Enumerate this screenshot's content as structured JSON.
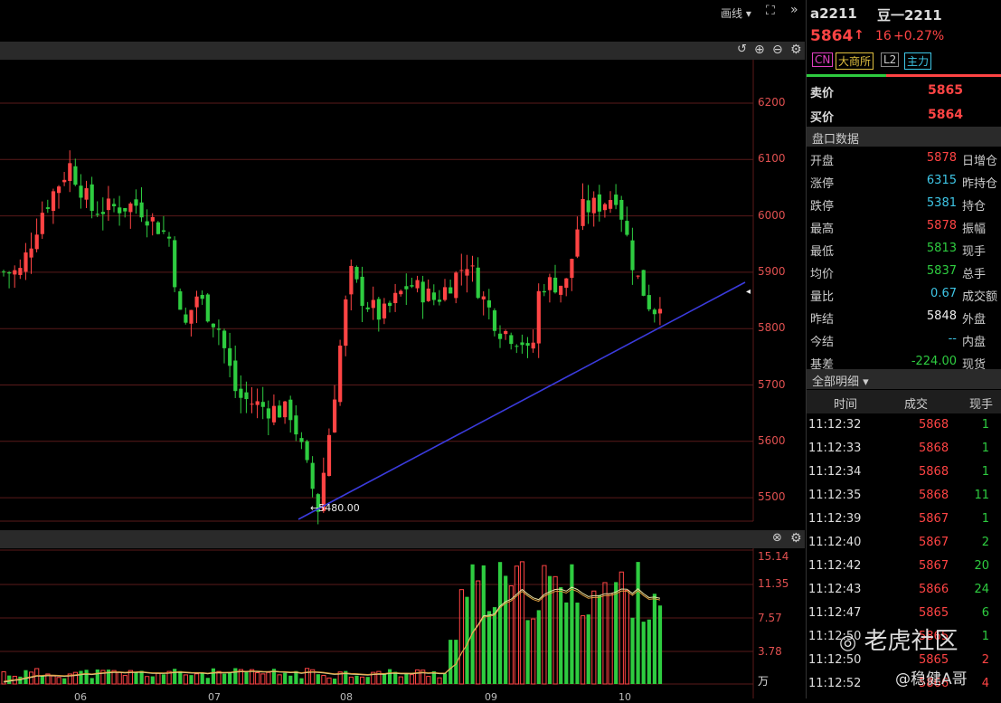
{
  "toolbar": {
    "draw_label": "画线 ▾",
    "fullscreen_icon": "expand-icon",
    "collapse_icon": "double-chevron-right-icon"
  },
  "chart_toolbar": {
    "icons": [
      "undo-icon",
      "zoom-in-icon",
      "zoom-out-icon",
      "gear-icon"
    ]
  },
  "vol_toolbar": {
    "icons": [
      "close-icon",
      "gear-icon"
    ]
  },
  "price_axis": [
    "6200",
    "6100",
    "6000",
    "5900",
    "5800",
    "5700",
    "5600",
    "5500"
  ],
  "vol_axis": [
    "15.14",
    "11.35",
    "7.57",
    "3.78",
    "万"
  ],
  "date_axis": [
    "06",
    "07",
    "08",
    "09",
    "10"
  ],
  "annotation": "←5480.00",
  "colors": {
    "up": "#ff4444",
    "down": "#2ecc40",
    "trendline": "#3b3bdd",
    "grid": "#5a1a1a"
  },
  "header": {
    "code": "a2211",
    "name": "豆一2211",
    "price": "5864",
    "arrow": "↑",
    "change": "16",
    "pct": "+0.27%"
  },
  "tags": [
    "CN",
    "大商所",
    "L2",
    "主力"
  ],
  "quote": {
    "sell_label": "卖价",
    "sell": "5865",
    "buy_label": "买价",
    "buy": "5864"
  },
  "panel_title": "盘口数据",
  "stats": [
    {
      "label": "开盘",
      "value": "5878",
      "color": "red",
      "label2": "日增仓"
    },
    {
      "label": "涨停",
      "value": "6315",
      "color": "cyan",
      "label2": "昨持仓"
    },
    {
      "label": "跌停",
      "value": "5381",
      "color": "cyan",
      "label2": "持仓"
    },
    {
      "label": "最高",
      "value": "5878",
      "color": "red",
      "label2": "振幅"
    },
    {
      "label": "最低",
      "value": "5813",
      "color": "green",
      "label2": "现手"
    },
    {
      "label": "均价",
      "value": "5837",
      "color": "green",
      "label2": "总手"
    },
    {
      "label": "量比",
      "value": "0.67",
      "color": "cyan",
      "label2": "成交额"
    },
    {
      "label": "昨结",
      "value": "5848",
      "color": "white",
      "label2": "外盘"
    },
    {
      "label": "今结",
      "value": "--",
      "color": "cyan",
      "label2": "内盘"
    },
    {
      "label": "基差",
      "value": "-224.00",
      "color": "green",
      "label2": "现货"
    }
  ],
  "trades_title": "全部明细 ▾",
  "trades_headers": [
    "时间",
    "成交",
    "现手"
  ],
  "trades": [
    {
      "time": "11:12:32",
      "price": "5868",
      "qty": "1",
      "color": "green"
    },
    {
      "time": "11:12:33",
      "price": "5868",
      "qty": "1",
      "color": "green"
    },
    {
      "time": "11:12:34",
      "price": "5868",
      "qty": "1",
      "color": "green"
    },
    {
      "time": "11:12:35",
      "price": "5868",
      "qty": "11",
      "color": "green"
    },
    {
      "time": "11:12:39",
      "price": "5867",
      "qty": "1",
      "color": "green"
    },
    {
      "time": "11:12:40",
      "price": "5867",
      "qty": "2",
      "color": "green"
    },
    {
      "time": "11:12:42",
      "price": "5867",
      "qty": "20",
      "color": "green"
    },
    {
      "time": "11:12:43",
      "price": "5866",
      "qty": "24",
      "color": "green"
    },
    {
      "time": "11:12:47",
      "price": "5865",
      "qty": "6",
      "color": "green"
    },
    {
      "time": "11:12:50",
      "price": "5865",
      "qty": "1",
      "color": "green"
    },
    {
      "time": "11:12:50",
      "price": "5865",
      "qty": "2",
      "color": "red"
    },
    {
      "time": "11:12:52",
      "price": "5866",
      "qty": "4",
      "color": "red"
    }
  ],
  "watermark": {
    "logo": "老虎社区",
    "author": "@稳健A哥"
  }
}
